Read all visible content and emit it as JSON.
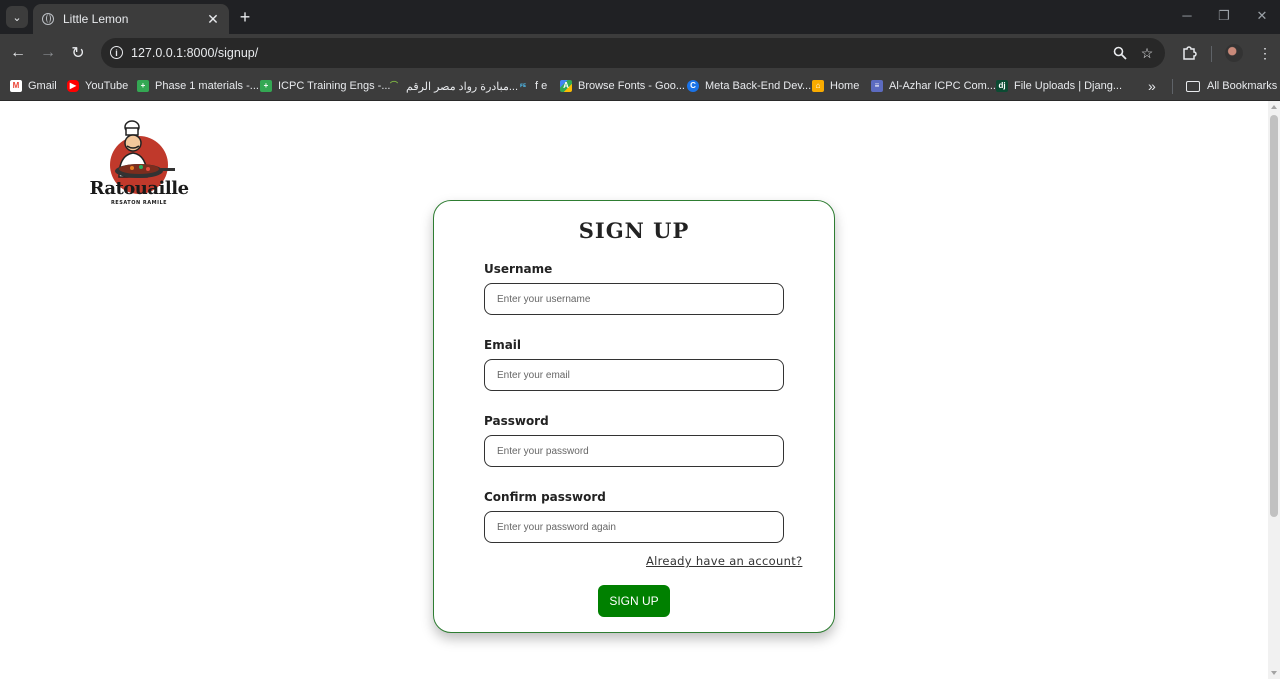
{
  "browser": {
    "tab_title": "Little Lemon",
    "url": "127.0.0.1:8000/signup/",
    "bookmarks": [
      {
        "label": "Gmail",
        "icon": "gmail-icon",
        "color": "#ea4335"
      },
      {
        "label": "YouTube",
        "icon": "youtube-icon",
        "color": "#ff0000"
      },
      {
        "label": "Phase 1 materials -...",
        "icon": "sheets-icon",
        "color": "#34a853"
      },
      {
        "label": "ICPC Training Engs -...",
        "icon": "sheets-icon",
        "color": "#34a853"
      },
      {
        "label": "مبادرة رواد مصر الرقم...",
        "icon": "initiative-icon",
        "color": "#7cb342"
      },
      {
        "label": "f e",
        "icon": "fe-icon",
        "color": "#4fc3f7"
      },
      {
        "label": "Browse Fonts - Goo...",
        "icon": "google-fonts-icon",
        "color": "#fbbc04"
      },
      {
        "label": "Meta Back-End Dev...",
        "icon": "coursera-icon",
        "color": "#1a73e8"
      },
      {
        "label": "Home",
        "icon": "home-icon",
        "color": "#f9ab00"
      },
      {
        "label": "Al-Azhar ICPC Com...",
        "icon": "forms-icon",
        "color": "#5c6bc0"
      },
      {
        "label": "File Uploads | Djang...",
        "icon": "django-icon",
        "color": "#0c4b33"
      }
    ],
    "more_bookmarks": "»",
    "all_bookmarks": "All Bookmarks"
  },
  "logo": {
    "name": "Ratouaille",
    "tagline": "RESATON RAMILE"
  },
  "form": {
    "title": "SIGN UP",
    "fields": [
      {
        "label": "Username",
        "placeholder": "Enter your username"
      },
      {
        "label": "Email",
        "placeholder": "Enter your email"
      },
      {
        "label": "Password",
        "placeholder": "Enter your password"
      },
      {
        "label": "Confirm password",
        "placeholder": "Enter your password again"
      }
    ],
    "login_link": "Already have an account?",
    "submit_label": "SIGN UP"
  }
}
